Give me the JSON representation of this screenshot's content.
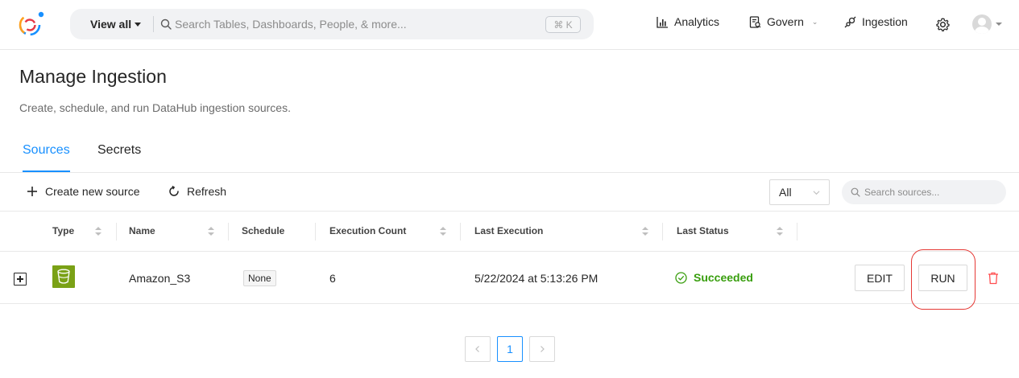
{
  "topnav": {
    "view_all": "View all",
    "search_placeholder": "Search Tables, Dashboards, People, & more...",
    "shortcut": "⌘ K",
    "links": {
      "analytics": "Analytics",
      "govern": "Govern",
      "ingestion": "Ingestion"
    }
  },
  "page": {
    "title": "Manage Ingestion",
    "subtitle": "Create, schedule, and run DataHub ingestion sources."
  },
  "tabs": [
    {
      "label": "Sources",
      "active": true
    },
    {
      "label": "Secrets",
      "active": false
    }
  ],
  "toolbar": {
    "create_label": "Create new source",
    "refresh_label": "Refresh",
    "filter_value": "All",
    "search_placeholder": "Search sources..."
  },
  "table": {
    "columns": [
      "Type",
      "Name",
      "Schedule",
      "Execution Count",
      "Last Execution",
      "Last Status"
    ],
    "rows": [
      {
        "type_icon": "s3-bucket-icon",
        "name": "Amazon_S3",
        "schedule": "None",
        "execution_count": "6",
        "last_execution": "5/22/2024 at 5:13:26 PM",
        "last_status": "Succeeded",
        "actions": {
          "edit": "EDIT",
          "run": "RUN"
        }
      }
    ]
  },
  "pagination": {
    "current_page": "1"
  },
  "colors": {
    "accent": "#1890ff",
    "success": "#389e0d",
    "highlight": "#e53935",
    "danger": "#ff4d4f",
    "s3_brand": "#7aa116"
  }
}
